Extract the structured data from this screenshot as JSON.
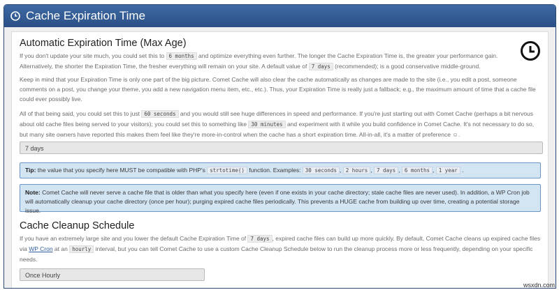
{
  "header": {
    "title": "Cache Expiration Time",
    "icon": "clock-icon"
  },
  "section1": {
    "heading": "Automatic Expiration Time (Max Age)",
    "p1_a": "If you don't update your site much, you could set this to ",
    "p1_code1": "6 months",
    "p1_b": " and optimize everything even further. The longer the Cache Expiration Time is, the greater your performance gain. Alternatively, the shorter the Expiration Time, the fresher everything will remain on your site. A default value of ",
    "p1_code2": "7 days",
    "p1_c": " (recommended); is a good conservative middle-ground.",
    "p2": "Keep in mind that your Expiration Time is only one part of the big picture. Comet Cache will also clear the cache automatically as changes are made to the site (i.e., you edit a post, someone comments on a post, you change your theme, you add a new navigation menu item, etc., etc.). Thus, your Expiration Time is really just a fallback; e.g., the maximum amount of time that a cache file could ever possibly live.",
    "p3_a": "All of that being said, you could set this to just ",
    "p3_code1": "60 seconds",
    "p3_b": " and you would still see huge differences in speed and performance. If you're just starting out with Comet Cache (perhaps a bit nervous about old cache files being served to your visitors); you could set this to something like ",
    "p3_code2": "30 minutes",
    "p3_c": " and experiment with it while you build confidence in Comet Cache. It's not necessary to do so, but many site owners have reported this makes them feel like they're more-in-control when the cache has a short expiration time. All-in-all, it's a matter of preference ☺.",
    "input_value": "7 days",
    "tip": {
      "label": "Tip:",
      "text_a": " the value that you specify here MUST be compatible with PHP's ",
      "code_fn": "strtotime()",
      "text_b": " function. Examples: ",
      "ex1": "30 seconds",
      "ex2": "2 hours",
      "ex3": "7 days",
      "ex4": "6 months",
      "ex5": "1 year",
      "sep": ", ",
      "end": " ."
    },
    "note": {
      "label": "Note:",
      "text": " Comet Cache will never serve a cache file that is older than what you specify here (even if one exists in your cache directory; stale cache files are never used). In addition, a WP Cron job will automatically cleanup your cache directory (once per hour); purging expired cache files periodically. This prevents a HUGE cache from building up over time, creating a potential storage issue."
    }
  },
  "section2": {
    "heading": "Cache Cleanup Schedule",
    "p_a": "If you have an extremely large site and you lower the default Cache Expiration Time of ",
    "p_code1": "7 days",
    "p_b": ", expired cache files can build up more quickly. By default, Comet Cache cleans up expired cache files via ",
    "p_link": "WP Cron",
    "p_c": " at an ",
    "p_code2": "hourly",
    "p_d": " interval, but you can tell Comet Cache to use a custom Cache Cleanup Schedule below to run the cleanup process more or less frequently, depending on your specific needs.",
    "select_value": "Once Hourly"
  },
  "watermark": "wsxdn.com"
}
